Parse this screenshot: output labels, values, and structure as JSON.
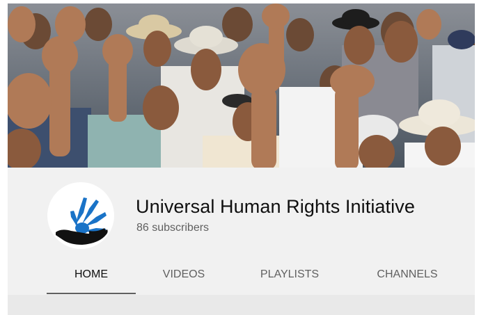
{
  "channel": {
    "name": "Universal Human Rights Initiative",
    "subscribers": "86 subscribers",
    "logo_colors": {
      "hand_blue": "#1a73c7",
      "hand_black": "#111111"
    }
  },
  "banner": {
    "scene": "crowd-raised-fists-photo"
  },
  "tabs": [
    {
      "label": "HOME",
      "active": true
    },
    {
      "label": "VIDEOS",
      "active": false
    },
    {
      "label": "PLAYLISTS",
      "active": false
    },
    {
      "label": "CHANNELS",
      "active": false
    }
  ],
  "colors": {
    "title_text": "#0f0f0f",
    "secondary_text": "#606060",
    "header_bg": "#f1f1f1"
  }
}
